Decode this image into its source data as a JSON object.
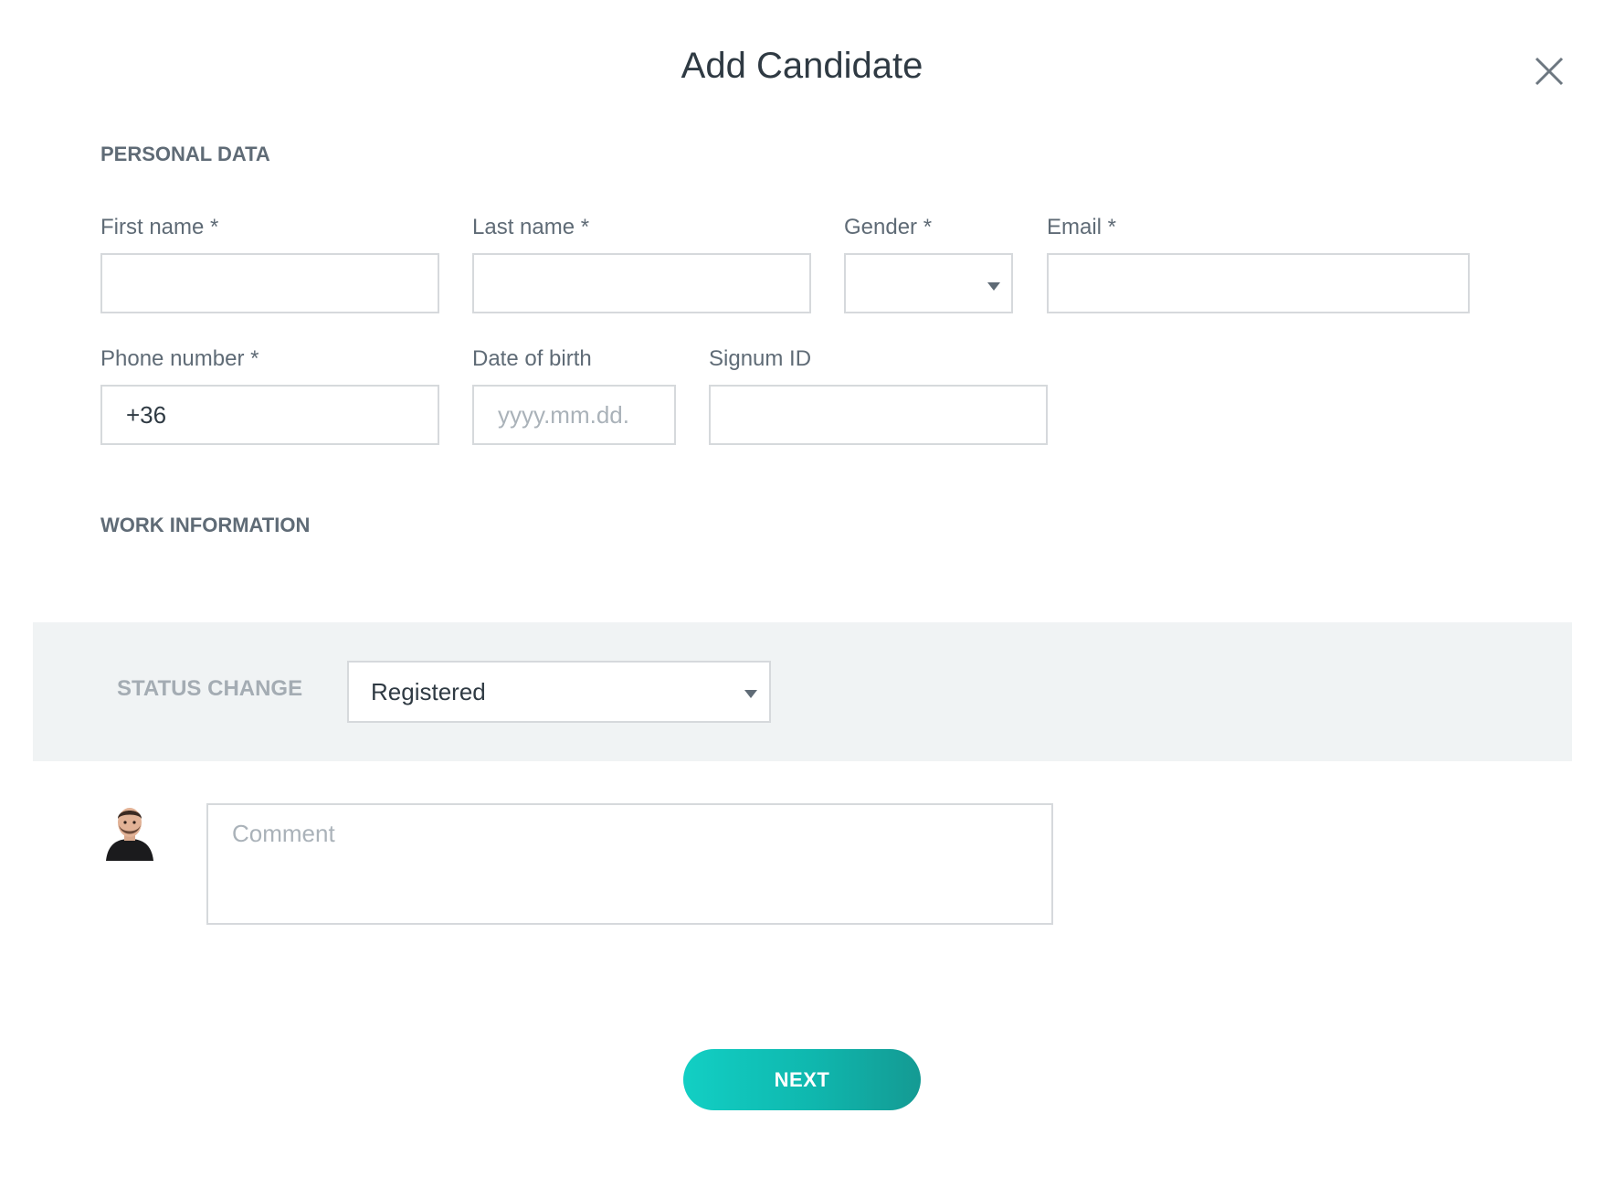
{
  "dialog": {
    "title": "Add Candidate",
    "close_icon": "close-icon"
  },
  "personal_data": {
    "heading": "PERSONAL DATA",
    "first_name": {
      "label": "First name *",
      "value": ""
    },
    "last_name": {
      "label": "Last name *",
      "value": ""
    },
    "gender": {
      "label": "Gender *",
      "value": ""
    },
    "email": {
      "label": "Email *",
      "value": ""
    },
    "phone": {
      "label": "Phone number *",
      "value": "+36"
    },
    "dob": {
      "label": "Date of birth",
      "placeholder": "yyyy.mm.dd."
    },
    "signum": {
      "label": "Signum ID",
      "value": ""
    }
  },
  "work_information": {
    "heading": "WORK INFORMATION"
  },
  "status_change": {
    "label": "STATUS CHANGE",
    "value": "Registered"
  },
  "comment": {
    "placeholder": "Comment"
  },
  "actions": {
    "next_label": "NEXT"
  },
  "colors": {
    "accent_start": "#12cfc4",
    "accent_end": "#149a93",
    "status_band": "#f0f3f4"
  }
}
